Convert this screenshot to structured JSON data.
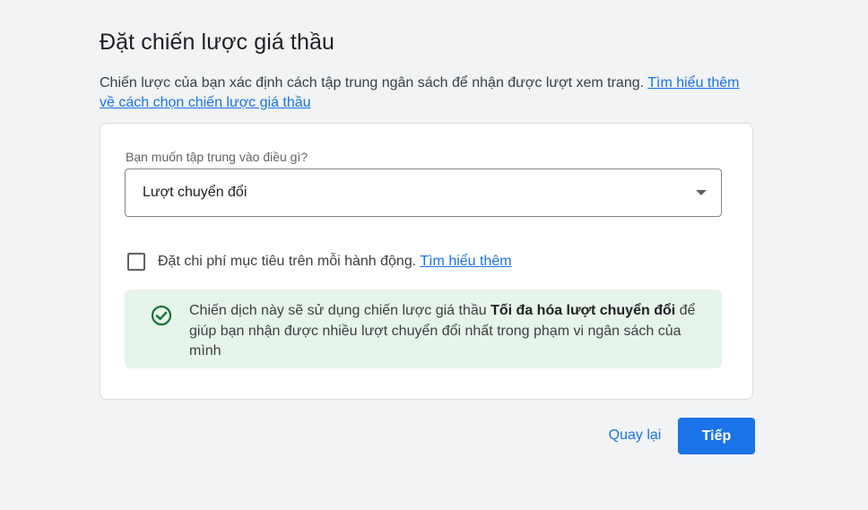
{
  "page": {
    "title": "Đặt chiến lược giá thầu",
    "intro_text": "Chiến lược của bạn xác định cách tập trung ngân sách để nhận được lượt xem trang. ",
    "intro_link": "Tìm hiểu thêm về cách chọn chiến lược giá thầu"
  },
  "card": {
    "focus_label": "Bạn muốn tập trung vào điều gì?",
    "focus_select_value": "Lượt chuyển đổi",
    "target_cost_checkbox": {
      "checked": false,
      "label": "Đặt chi phí mục tiêu trên mỗi hành động. ",
      "link": "Tìm hiểu thêm"
    },
    "info": {
      "icon": "check-circle-icon",
      "text_before": "Chiến dịch này sẽ sử dụng chiến lược giá thầu ",
      "text_bold": "Tối đa hóa lượt chuyển đổi",
      "text_after": " để giúp bạn nhận được nhiều lượt chuyển đổi nhất trong phạm vi ngân sách của mình"
    }
  },
  "footer": {
    "back_label": "Quay lại",
    "next_label": "Tiếp"
  },
  "colors": {
    "background": "#f1f3f4",
    "accent": "#1a73e8",
    "info_background": "#e6f4ea",
    "success_icon": "#137333"
  }
}
